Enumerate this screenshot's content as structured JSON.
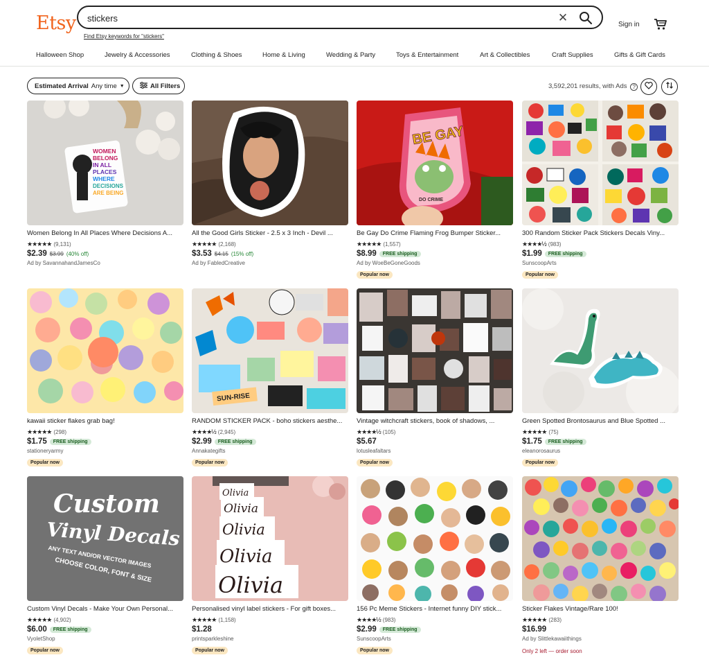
{
  "header": {
    "logo": "Etsy",
    "search_value": "stickers",
    "keyword_link": "Find Etsy keywords for \"stickers\"",
    "sign_in": "Sign in"
  },
  "categories": [
    "Halloween Shop",
    "Jewelry & Accessories",
    "Clothing & Shoes",
    "Home & Living",
    "Wedding & Party",
    "Toys & Entertainment",
    "Art & Collectibles",
    "Craft Supplies",
    "Gifts & Gift Cards"
  ],
  "filters": {
    "arrival_label": "Estimated Arrival",
    "arrival_value": "Any time",
    "all_filters": "All Filters",
    "results": "3,592,201 results, with Ads"
  },
  "listings": [
    {
      "title": "Women Belong In All Places Where Decisions A...",
      "reviews": "(9,131)",
      "price": "$2.39",
      "original_price": "$3.99",
      "discount": "(40% off)",
      "shop": "Ad by SavannahandJamesCo"
    },
    {
      "title": "All the Good Girls Sticker - 2.5 x 3 Inch - Devil ...",
      "reviews": "(2,168)",
      "price": "$3.53",
      "original_price": "$4.15",
      "discount": "(15% off)",
      "shop": "Ad by FabledCreative"
    },
    {
      "title": "Be Gay Do Crime Flaming Frog Bumper Sticker...",
      "reviews": "(1,557)",
      "price": "$8.99",
      "free_shipping": "FREE shipping",
      "shop": "Ad by WoeBeGoneGoods",
      "badge": "Popular now"
    },
    {
      "title": "300 Random Sticker Pack Stickers Decals Viny...",
      "reviews": "(983)",
      "price": "$1.99",
      "free_shipping": "FREE shipping",
      "shop": "SunscoopArts",
      "badge": "Popular now"
    },
    {
      "title": "kawaii sticker flakes grab bag!",
      "reviews": "(298)",
      "price": "$1.75",
      "free_shipping": "FREE shipping",
      "shop": "stationeryarmy",
      "badge": "Popular now"
    },
    {
      "title": "RANDOM STICKER PACK - boho stickers aesthe...",
      "reviews": "(2,945)",
      "price": "$2.99",
      "free_shipping": "FREE shipping",
      "shop": "Annakategifts",
      "badge": "Popular now"
    },
    {
      "title": "Vintage witchcraft stickers, book of shadows, ...",
      "reviews": "(105)",
      "price": "$5.67",
      "shop": "lotusleafaltars",
      "badge": "Popular now"
    },
    {
      "title": "Green Spotted Brontosaurus and Blue Spotted ...",
      "reviews": "(75)",
      "price": "$1.75",
      "free_shipping": "FREE shipping",
      "shop": "eleanorosaurus",
      "badge": "Popular now"
    },
    {
      "title": "Custom Vinyl Decals - Make Your Own Personal...",
      "reviews": "(4,902)",
      "price": "$6.00",
      "free_shipping": "FREE shipping",
      "shop": "VyoletShop",
      "badge": "Popular now"
    },
    {
      "title": "Personalised vinyl label stickers - For gift boxes...",
      "reviews": "(1,158)",
      "price": "$1.28",
      "shop": "printsparkleshine",
      "badge": "Popular now"
    },
    {
      "title": "156 Pc Meme Stickers - Internet funny DIY stick...",
      "reviews": "(983)",
      "price": "$2.99",
      "free_shipping": "FREE shipping",
      "shop": "SunscoopArts",
      "badge": "Popular now"
    },
    {
      "title": "Sticker Flakes Vintage/Rare 100!",
      "reviews": "(283)",
      "price": "$16.99",
      "shop": "Ad by Slittlekawaiithings",
      "stock": "Only 2 left — order soon"
    }
  ],
  "image_text": {
    "women": [
      "WOMEN",
      "BELONG",
      "IN ALL",
      "PLACES",
      "WHERE",
      "DECISIONS",
      "ARE BEING"
    ],
    "gay": "BE GAY",
    "crime": "DO CRIME",
    "sunrise": "SUN-RISE",
    "custom1": "Custom",
    "custom2": "Vinyl Decals",
    "custom3": "ANY TEXT AND/OR VECTOR IMAGES",
    "custom4": "CHOOSE COLOR, FONT & SIZE",
    "olivia": "Olivia"
  },
  "colors": {
    "brand": "#f1641e",
    "free_shipping_bg": "#d4e9d7",
    "popular_bg": "#fbe7c1",
    "stock_red": "#a61a2e"
  },
  "icons": {
    "clear": "close-icon",
    "search": "search-icon",
    "cart": "cart-icon",
    "favorite": "heart-icon",
    "sort": "sort-icon",
    "help": "help-icon",
    "filters": "filters-icon"
  }
}
